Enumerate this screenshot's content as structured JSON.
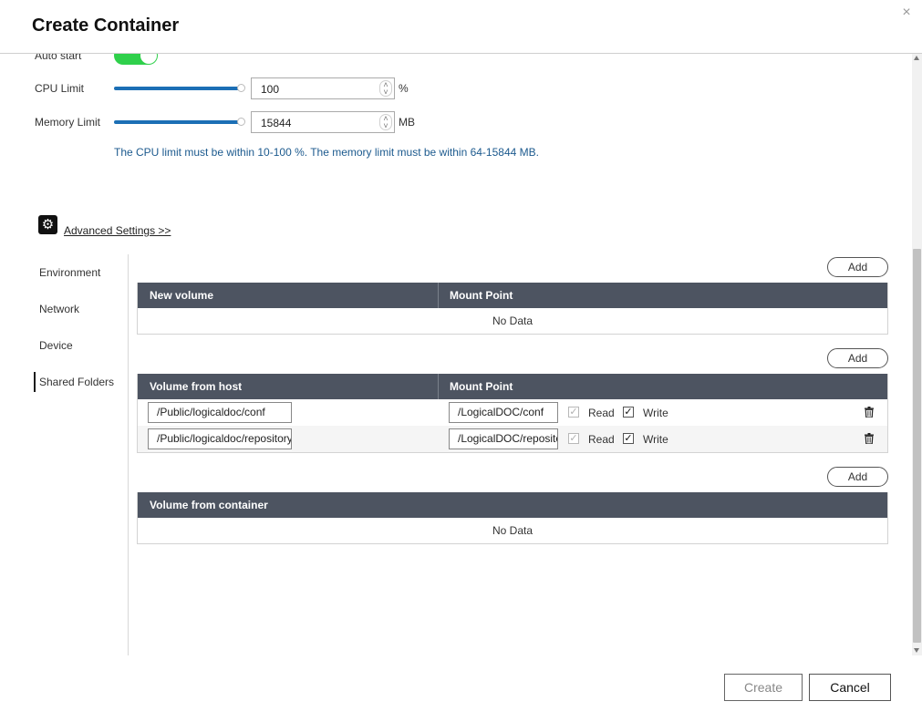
{
  "dialog": {
    "title": "Create Container",
    "close_glyph": "×"
  },
  "settings": {
    "auto_start_label": "Auto start",
    "auto_start_on": true,
    "cpu_label": "CPU Limit",
    "cpu_value": "100",
    "cpu_unit": "%",
    "memory_label": "Memory Limit",
    "memory_value": "15844",
    "memory_unit": "MB",
    "limit_hint": "The CPU limit must be within 10-100 %. The memory limit must be within 64-15844 MB.",
    "advanced_link": "Advanced Settings >>",
    "gear_icon": "gear-icon"
  },
  "side_nav": {
    "items": [
      {
        "label": "Environment"
      },
      {
        "label": "Network"
      },
      {
        "label": "Device"
      },
      {
        "label": "Shared Folders"
      }
    ],
    "active_index": 3
  },
  "volumes": {
    "add_label": "Add",
    "new_volume_header": "New volume",
    "mount_point_header": "Mount Point",
    "no_data": "No Data"
  },
  "host_volumes": {
    "add_label": "Add",
    "host_header": "Volume from host",
    "mount_point_header": "Mount Point",
    "read_label": "Read",
    "write_label": "Write",
    "rows": [
      {
        "host_path": "/Public/logicaldoc/conf",
        "mount_point": "/LogicalDOC/conf",
        "read": true,
        "write": true
      },
      {
        "host_path": "/Public/logicaldoc/repository",
        "mount_point": "/LogicalDOC/repository",
        "read": true,
        "write": true
      }
    ]
  },
  "container_volumes": {
    "add_label": "Add",
    "header": "Volume from container",
    "no_data": "No Data"
  },
  "footer": {
    "create_label": "Create",
    "cancel_label": "Cancel"
  }
}
